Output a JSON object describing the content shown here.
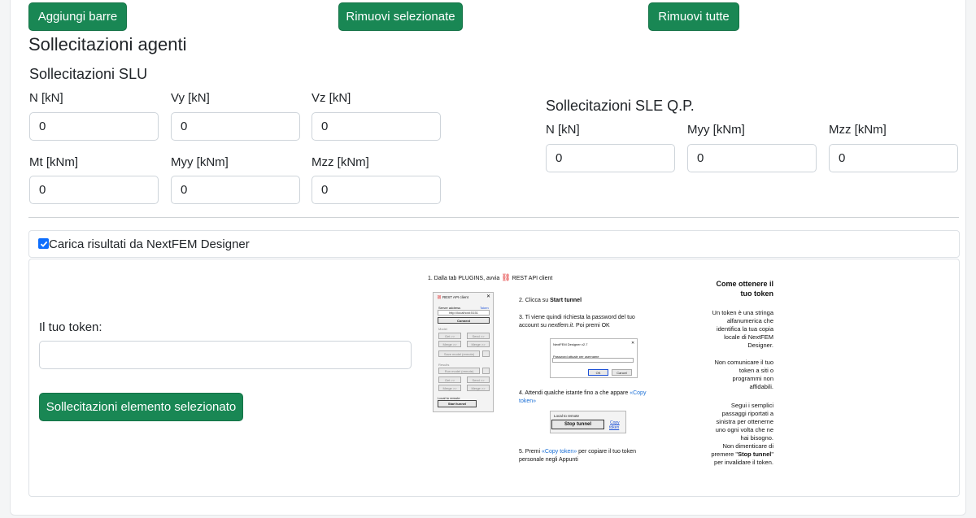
{
  "toolbar": {
    "add_label": "Aggiungi barre",
    "remove_selected_label": "Rimuovi selezionate",
    "remove_all_label": "Rimuovi tutte"
  },
  "section_title": "Sollecitazioni agenti",
  "slu": {
    "title": "Sollecitazioni SLU",
    "fields": [
      {
        "label": "N [kN]",
        "value": "0"
      },
      {
        "label": "Vy [kN]",
        "value": "0"
      },
      {
        "label": "Vz [kN]",
        "value": "0"
      },
      {
        "label": "Mt [kNm]",
        "value": "0"
      },
      {
        "label": "Myy [kNm]",
        "value": "0"
      },
      {
        "label": "Mzz [kNm]",
        "value": "0"
      }
    ]
  },
  "sle": {
    "title": "Sollecitazioni SLE Q.P.",
    "fields": [
      {
        "label": "N [kN]",
        "value": "0"
      },
      {
        "label": "Myy [kNm]",
        "value": "0"
      },
      {
        "label": "Mzz [kNm]",
        "value": "0"
      }
    ]
  },
  "nextfem": {
    "checkbox_label": "Carica risultati da NextFEM Designer",
    "checked": true,
    "token_label": "Il tuo token:",
    "token_value": "",
    "action_label": "Sollecitazioni elemento selezionato"
  },
  "guide": {
    "step1": "1. Dalla tab PLUGINS, avvia",
    "step1_link": "REST API client",
    "step2_pre": "2. Clicca su ",
    "step2_bold": "Start tunnel",
    "step3_a": "3. Ti viene quindi richiesta la password del tuo",
    "step3_b_pre": "account su ",
    "step3_b_it": "nextfem.it",
    "step3_b_post": ". Poi premi OK",
    "step4_a_pre": "4. Attendi qualche istante fino a che appare ",
    "step4_a_link": "«Copy",
    "step4_b_link": "token»",
    "step5_a_pre": "5. Premi ",
    "step5_a_link": "«Copy token»",
    "step5_a_post": " per copiare il tuo token",
    "step5_b": "personale negli Appunti",
    "client_window": {
      "title": "REST API client",
      "server_label": "Server address",
      "token_link": "Token",
      "address": "http://localhost:5151",
      "connect": "Connect",
      "model_label": "Model",
      "get": "Get >>",
      "send": "Send >>",
      "merge_l": "Merge >>",
      "merge_r": "Merge >>",
      "save_model": "Save model (remote)",
      "results_label": "Results",
      "run_model": "Run model (remote)",
      "local_remote": "Local to remote",
      "start_tunnel": "Start tunnel"
    },
    "pwd_dialog": {
      "title": "NextFEM Designer v2.7",
      "prompt": "Password attuale per username",
      "ok": "OK",
      "cancel": "Cancel"
    },
    "tunnel_box": {
      "label": "Local to remote",
      "stop": "Stop tunnel",
      "copy_a": "Copy",
      "copy_b": "token"
    },
    "side_title_a": "Come ottenere il",
    "side_title_b": "tuo token",
    "side_p1": [
      "Un token è una stringa",
      "alfanumerica che",
      "identifica la tua copia",
      "locale di NextFEM",
      "Designer."
    ],
    "side_p2": [
      "Non comunicare il tuo",
      "token a siti o",
      "programmi non",
      "affidabili."
    ],
    "side_p3": [
      "Segui i semplici",
      "passaggi riportati a",
      "sinistra per ottenerne",
      "uno ogni volta che ne",
      "hai bisogno.",
      "Non dimenticare di"
    ],
    "side_p4_pre": "premere \"",
    "side_p4_bold": "Stop tunnel",
    "side_p4_post": "\"",
    "side_p5": "per invalidare il token."
  }
}
